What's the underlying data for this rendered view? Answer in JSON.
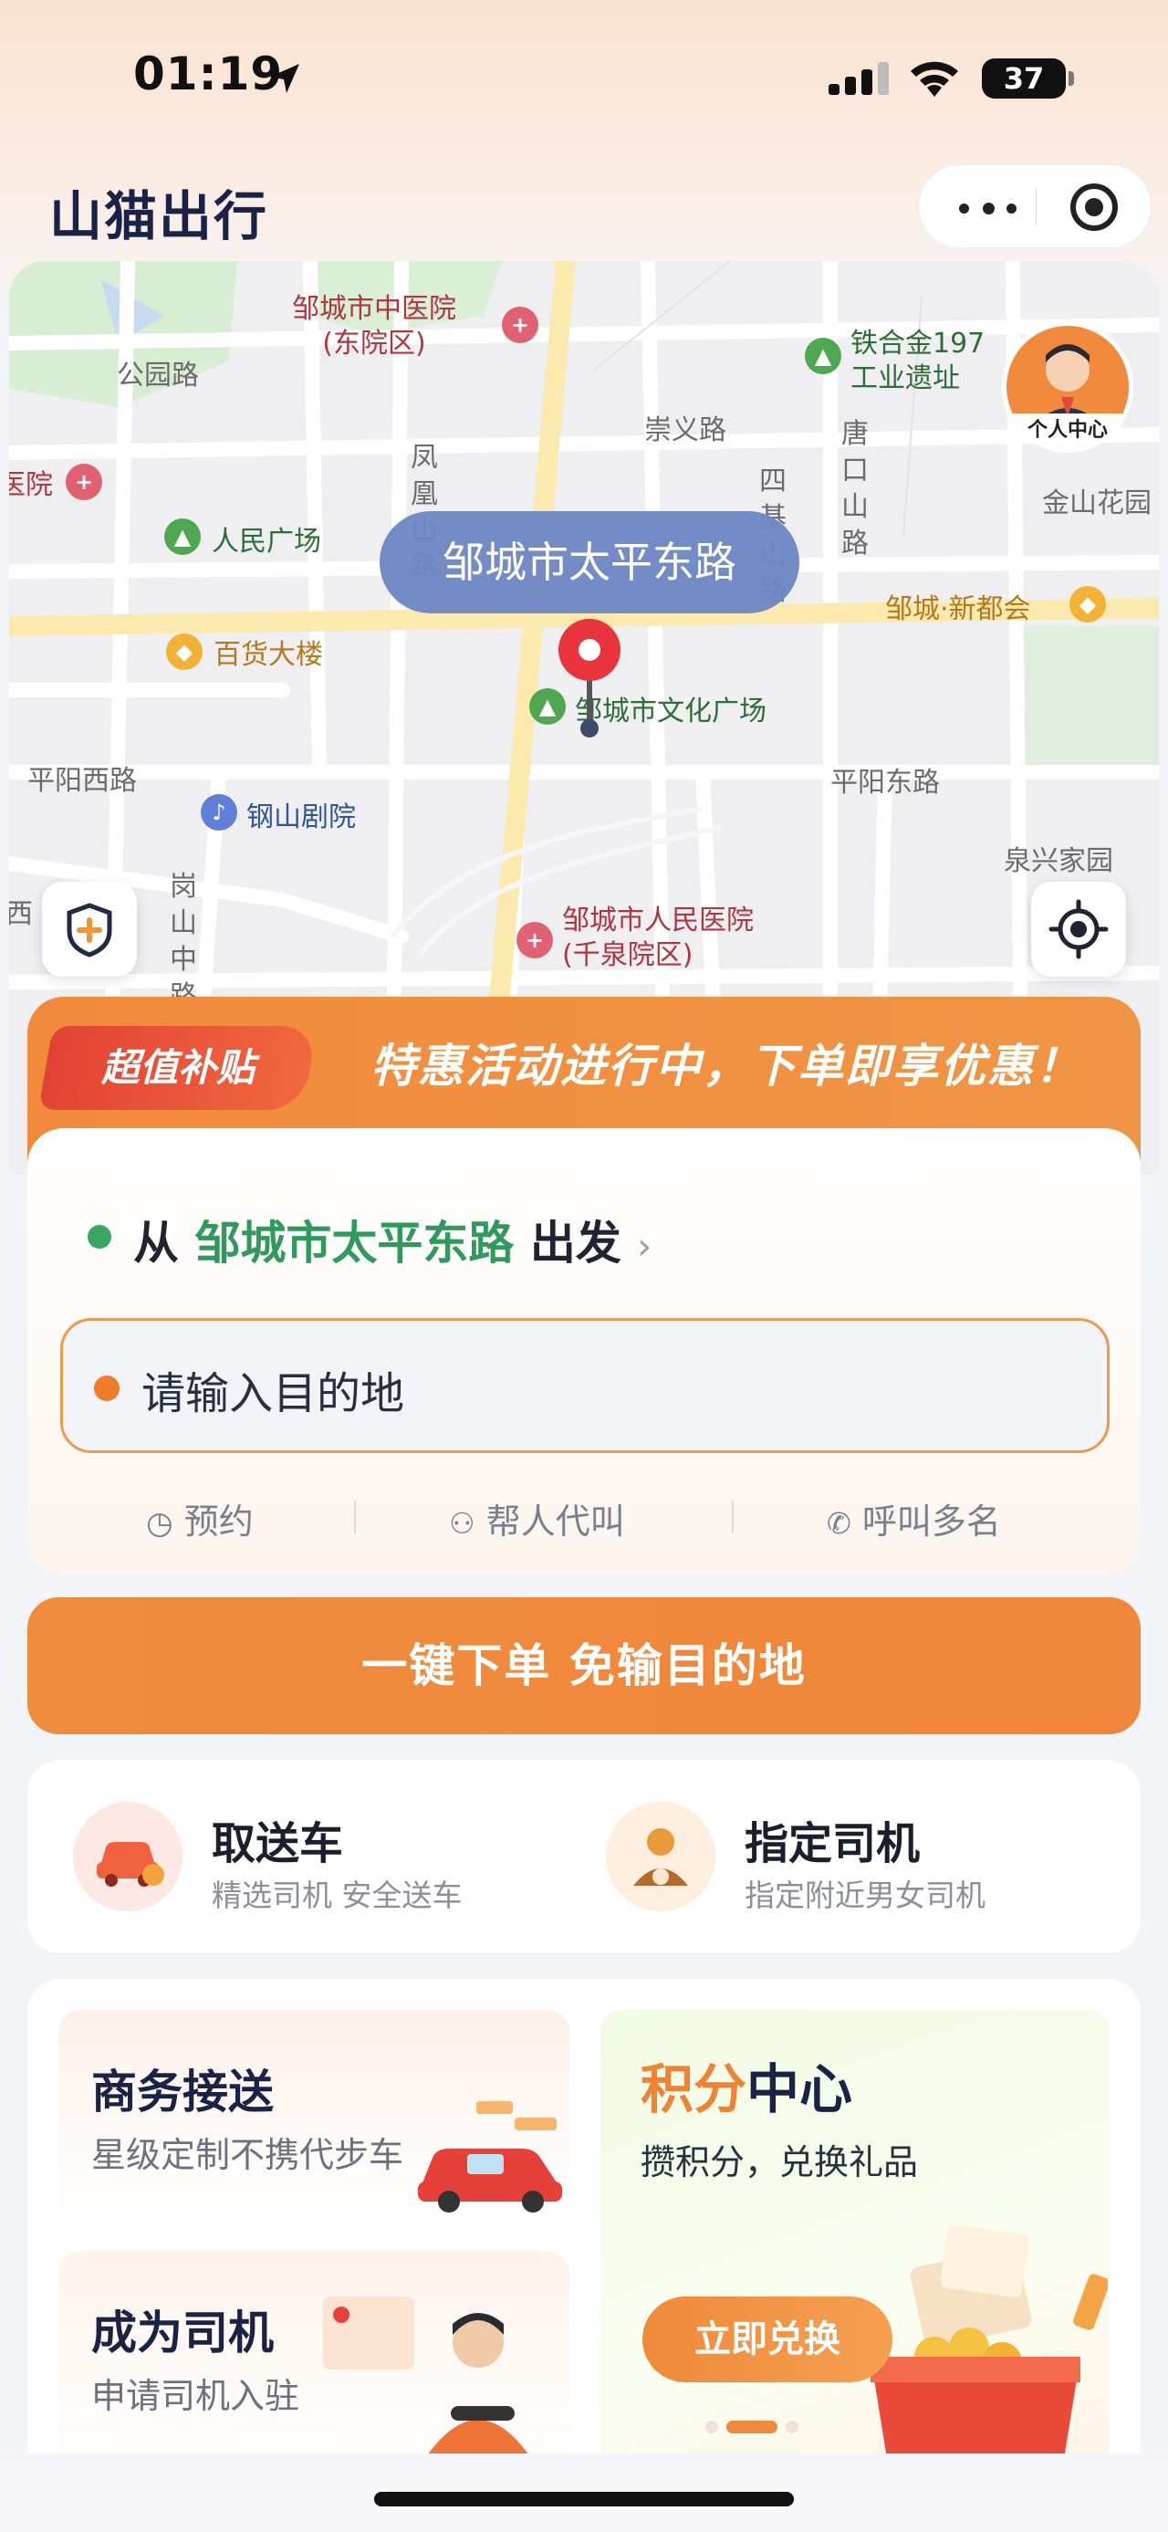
{
  "status_bar": {
    "time": "01:19",
    "battery": "37"
  },
  "header": {
    "app_title": "山猫出行"
  },
  "map": {
    "current_location_bubble": "邹城市太平东路",
    "avatar_label": "个人中心",
    "pois": {
      "hospital_east": "邹城市中医院",
      "hospital_east_sub": "(东院区)",
      "tiehejin": "铁合金197",
      "tiehejin_sub": "工业遗址",
      "gongyuan_road": "公园路",
      "chongyi_road": "崇义路",
      "tangkou_road": "唐口山路",
      "siji_road": "四基山路",
      "fenghuang_road": "凤凰山路",
      "yuan_left": "医院",
      "renmin_square": "人民广场",
      "jinshan": "金山花园",
      "xinduhui": "邹城·新都会",
      "baihuo": "百货大楼",
      "culture_square": "邹城市文化广场",
      "pingyang_west": "平阳西路",
      "pingyang_east": "平阳东路",
      "gangshan_theater": "钢山剧院",
      "quanxing": "泉兴家园",
      "gangshan_middle": "岗山中路",
      "xi": "西",
      "people_hospital": "邹城市人民医院",
      "people_hospital_sub": "(千泉院区)"
    }
  },
  "order": {
    "promo_tag": "超值补贴",
    "promo_text": "特惠活动进行中，下单即享优惠！",
    "from_prefix": "从",
    "from_location": "邹城市太平东路",
    "from_suffix": "出发",
    "destination_placeholder": "请输入目的地",
    "options": [
      "预约",
      "帮人代叫",
      "呼叫多名"
    ],
    "one_click_button": "一键下单 免输目的地"
  },
  "services": [
    {
      "title": "取送车",
      "subtitle": "精选司机 安全送车"
    },
    {
      "title": "指定司机",
      "subtitle": "指定附近男女司机"
    }
  ],
  "tiles": {
    "business": {
      "title": "商务接送",
      "subtitle": "星级定制不携代步车"
    },
    "driver": {
      "title": "成为司机",
      "subtitle": "申请司机入驻"
    },
    "points": {
      "title_a": "积分",
      "title_b": "中心",
      "subtitle": "攒积分，兑换礼品",
      "button": "立即兑换"
    }
  },
  "colors": {
    "accent_orange": "#ef8a3a",
    "green": "#2f9a5c",
    "title_navy": "#1a2246"
  }
}
